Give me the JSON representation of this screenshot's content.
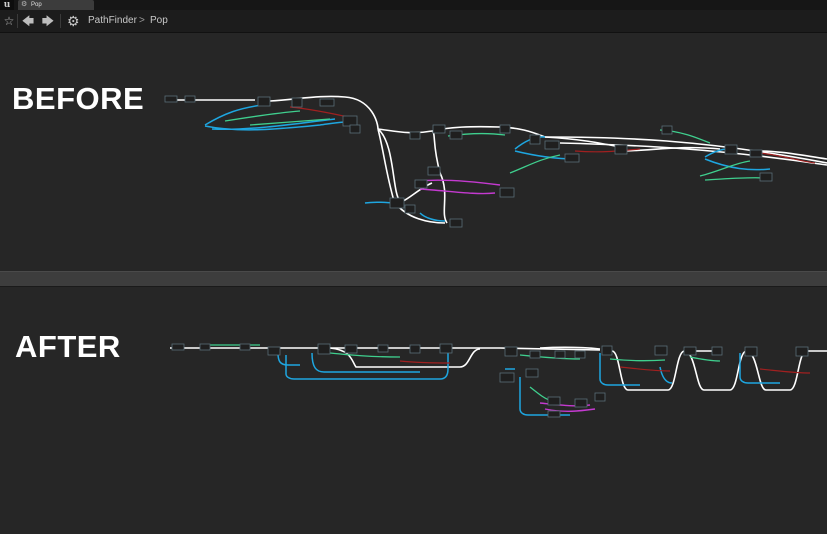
{
  "app": {
    "tab_title": "Pop",
    "logo_letter": "u"
  },
  "toolbar": {
    "favorite_icon": "star-icon",
    "back_icon": "arrow-left-icon",
    "forward_icon": "arrow-right-icon",
    "breadcrumb_icon": "gear-icon",
    "breadcrumb": [
      "PathFinder",
      "Pop"
    ],
    "breadcrumb_separator": ">"
  },
  "panels": {
    "before_label": "BEFORE",
    "after_label": "AFTER"
  },
  "colors": {
    "background": "#262626",
    "exec_wire": "#ffffff",
    "object_wire": "#1ea6e0",
    "float_wire": "#3fcf8e",
    "struct_wire": "#c43ad0",
    "bool_wire": "#a02020",
    "node_body": "#1f1f1f",
    "node_header": "#5a6e77"
  }
}
